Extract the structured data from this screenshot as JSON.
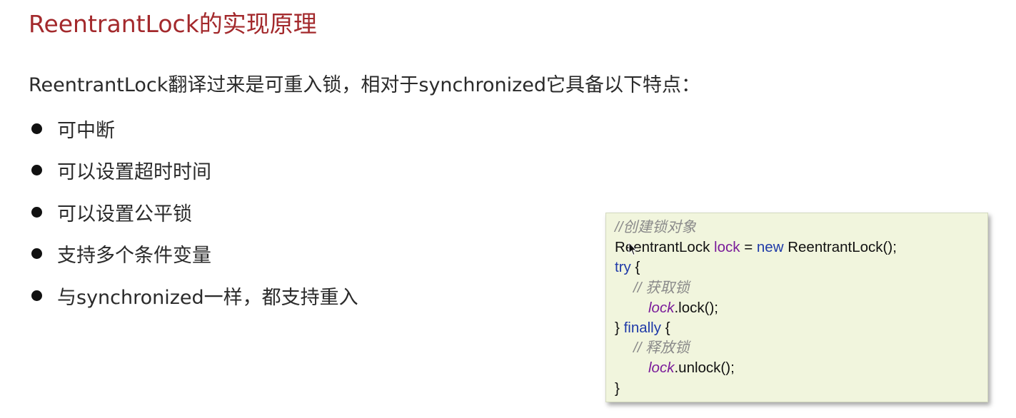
{
  "slide": {
    "title": "ReentrantLock的实现原理",
    "intro": "ReentrantLock翻译过来是可重入锁，相对于synchronized它具备以下特点：",
    "bullets": [
      "可中断",
      "可以设置超时时间",
      "可以设置公平锁",
      "支持多个条件变量",
      "与synchronized一样，都支持重入"
    ]
  },
  "code": {
    "comment_create": "//创建锁对象",
    "type_name": "ReentrantLock",
    "var_lock": "lock",
    "op_assign": "=",
    "kw_new": "new",
    "ctor_call": "ReentrantLock();",
    "kw_try": "try",
    "brace_open": "{",
    "comment_acquire": "// 获取锁",
    "call_lock": ".lock();",
    "brace_close": "}",
    "kw_finally": "finally",
    "comment_release": "// 释放锁",
    "call_unlock": ".unlock();"
  },
  "colors": {
    "title": "#a3292c",
    "code_background": "#f1f5dd",
    "keyword": "#1f3aa8",
    "variable": "#7a1c9a",
    "comment": "#8a8a8a"
  }
}
